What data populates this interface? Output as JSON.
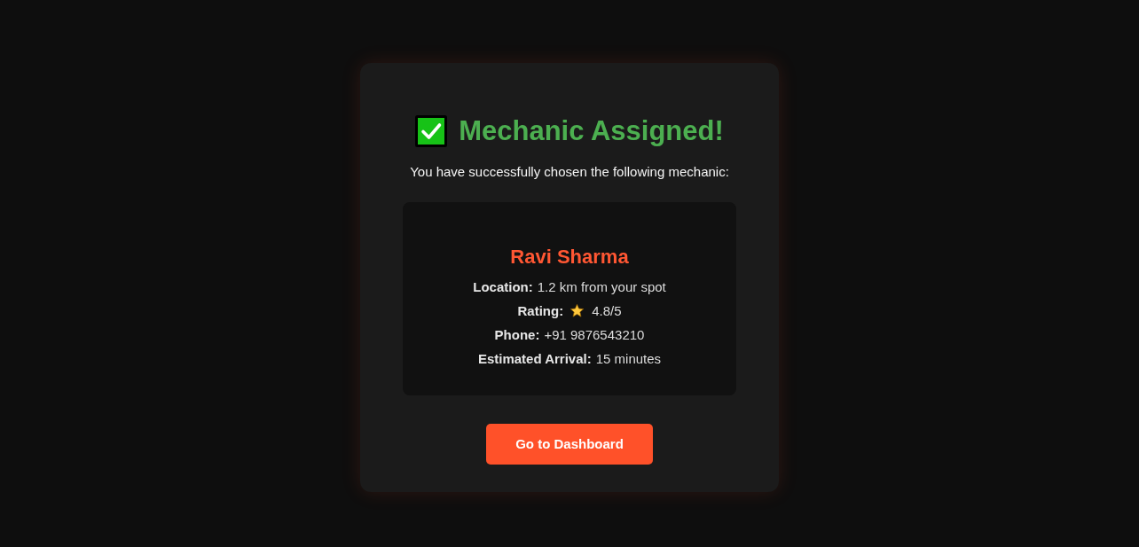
{
  "header": {
    "title": "Mechanic Assigned!",
    "message": "You have successfully chosen the following mechanic:"
  },
  "mechanic": {
    "name": "Ravi Sharma",
    "details": [
      {
        "kind": "text",
        "label": "Location:",
        "value": "1.2 km from your spot"
      },
      {
        "kind": "rating",
        "label": "Rating:",
        "value": "4.8/5"
      },
      {
        "kind": "text",
        "label": "Phone:",
        "value": "+91 9876543210"
      },
      {
        "kind": "text",
        "label": "Estimated Arrival:",
        "value": "15 minutes"
      }
    ]
  },
  "button": {
    "label": "Go to Dashboard"
  }
}
